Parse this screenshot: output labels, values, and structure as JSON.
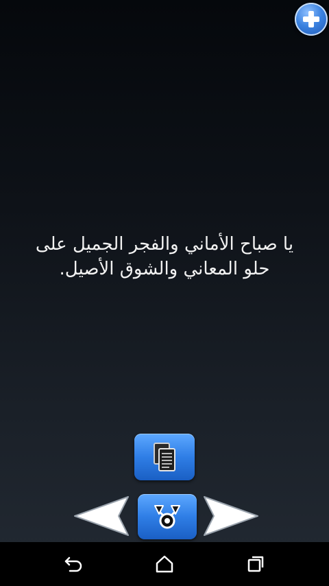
{
  "app": {
    "message": "يا صباح الأماني والفجر الجميل على حلو المعاني والشوق الأصيل."
  },
  "controls": {
    "add_icon": "plus-icon",
    "copy_icon": "copy-icon",
    "share_icon": "share-icon",
    "prev_icon": "arrow-left-icon",
    "next_icon": "arrow-right-icon"
  },
  "system_nav": {
    "back_icon": "back-icon",
    "home_icon": "home-icon",
    "recents_icon": "recents-icon"
  },
  "colors": {
    "accent": "#2f7ee6",
    "text": "#f2f2f2",
    "navbar": "#000000"
  }
}
